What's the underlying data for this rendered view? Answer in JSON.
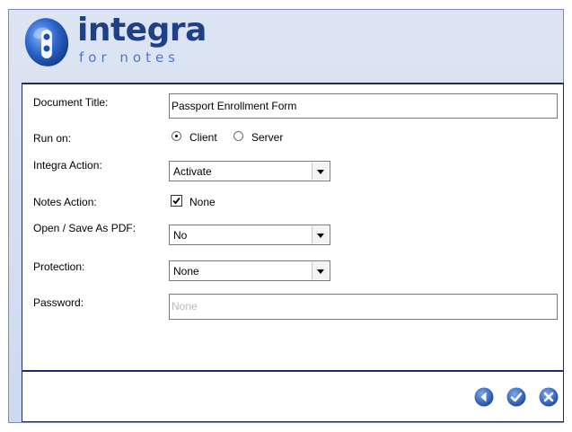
{
  "brand": {
    "name": "integra",
    "tagline": "for notes",
    "primary_color": "#1f3f87",
    "accent_color": "#4d78c6"
  },
  "form": {
    "document_title": {
      "label": "Document Title:",
      "value": "Passport Enrollment Form"
    },
    "run_on": {
      "label": "Run on:",
      "options": [
        "Client",
        "Server"
      ],
      "selected": "Client"
    },
    "integra_action": {
      "label": "Integra Action:",
      "value": "Activate"
    },
    "notes_action": {
      "label": "Notes Action:",
      "checkbox_label": "None",
      "checked": true
    },
    "open_save_pdf": {
      "label": "Open / Save As PDF:",
      "value": "No"
    },
    "protection": {
      "label": "Protection:",
      "value": "None"
    },
    "password": {
      "label": "Password:",
      "placeholder": "None"
    }
  },
  "footer": {
    "buttons": [
      {
        "icon": "back-arrow-icon",
        "color": "#2d5bb5"
      },
      {
        "icon": "checkmark-icon",
        "color": "#2d5bb5"
      },
      {
        "icon": "close-x-icon",
        "color": "#2d5bb5"
      }
    ]
  }
}
